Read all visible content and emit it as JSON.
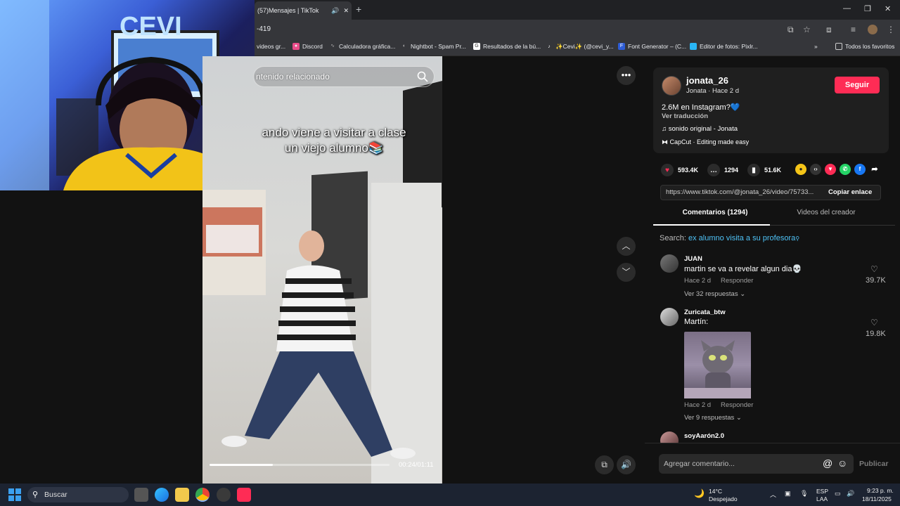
{
  "browser": {
    "tab_title": "(57)Mensajes | TikTok",
    "new_tab": "+",
    "url": "-419",
    "window_controls": [
      "—",
      "❐",
      "✕"
    ],
    "bookmarks": [
      {
        "label": "videos gr...",
        "icon": "bookmark-icon"
      },
      {
        "label": "Discord",
        "icon": "discord-icon"
      },
      {
        "label": "Calculadora gráfica...",
        "icon": "desmos-icon"
      },
      {
        "label": "Nightbot - Spam Pr...",
        "icon": "nightbot-icon"
      },
      {
        "label": "Resultados de la bú...",
        "icon": "search-result-icon"
      },
      {
        "label": "✨Cevi✨ (@cevi_y...",
        "icon": "tiktok-icon"
      },
      {
        "label": "Font Generator – (C...",
        "icon": "font-icon"
      },
      {
        "label": "Editor de fotos: Pixlr...",
        "icon": "pixlr-icon"
      }
    ],
    "bookmarks_overflow": "»",
    "all_bookmarks": "Todos los favoritos"
  },
  "video": {
    "search_placeholder": "ntenido relacionado",
    "caption_line1": "ando viene a visitar a clase",
    "caption_line2": "un viejo alumno📚",
    "time": "00:24/01:11",
    "progress": 0.35
  },
  "creator": {
    "username": "jonata_26",
    "subtitle": "Jonata · Hace 2 d",
    "follow": "Seguir",
    "description": "2.6M en Instagram?💙",
    "translate": "Ver traducción",
    "music": "sonido original - Jonata",
    "capcut": "CapCut · Editing made easy"
  },
  "stats": {
    "likes": "593.4K",
    "comments": "1294",
    "saves": "51.6K"
  },
  "link": {
    "url": "https://www.tiktok.com/@jonata_26/video/75733...",
    "copy": "Copiar enlace"
  },
  "tabs": {
    "comments": "Comentarios (1294)",
    "videos": "Videos del creador"
  },
  "search_suggestion": {
    "prefix": "Search: ",
    "query": "ex alumno visita a su profesora"
  },
  "comments": [
    {
      "user": "JUAN",
      "text": "martin se va a revelar algun dia💀",
      "time": "Hace 2 d",
      "reply": "Responder",
      "replies": "Ver 32 respuestas",
      "likes": "39.7K"
    },
    {
      "user": "Zuricata_btw",
      "text": "Martín:",
      "time": "Hace 2 d",
      "reply": "Responder",
      "replies": "Ver 9 respuestas",
      "likes": "19.8K"
    },
    {
      "user": "soyAarón2.0"
    }
  ],
  "comment_bar": {
    "placeholder": "Agregar comentario...",
    "publish": "Publicar"
  },
  "taskbar": {
    "search": "Buscar",
    "weather_temp": "14°C",
    "weather_desc": "Despejado",
    "lang1": "ESP",
    "lang2": "LAA",
    "time": "9:23 p. m.",
    "date": "18/11/2025"
  }
}
